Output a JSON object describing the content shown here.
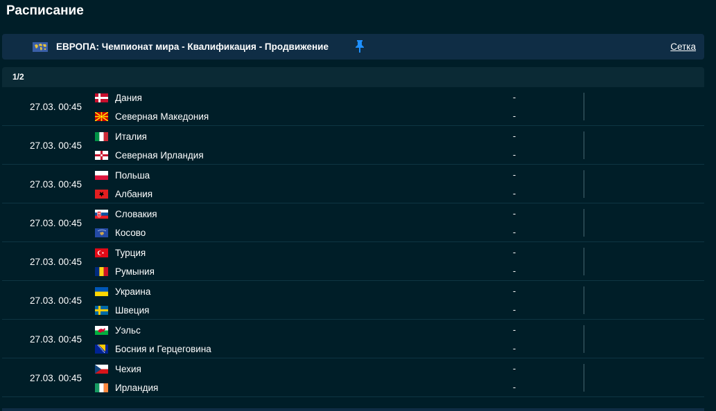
{
  "page": {
    "title": "Расписание"
  },
  "league": {
    "title": "ЕВРОПА: Чемпионат мира - Квалификация - Продвижение",
    "bracket_link": "Сетка",
    "flag_icon": "world-map-icon",
    "pin_icon": "pin-icon",
    "pin_color": "#1e90ff"
  },
  "round": {
    "label": "1/2"
  },
  "matches": [
    {
      "time": "27.03. 00:45",
      "home": {
        "name": "Дания",
        "flag": "denmark"
      },
      "away": {
        "name": "Северная Македония",
        "flag": "north-macedonia"
      },
      "home_score": "-",
      "away_score": "-"
    },
    {
      "time": "27.03. 00:45",
      "home": {
        "name": "Италия",
        "flag": "italy"
      },
      "away": {
        "name": "Северная Ирландия",
        "flag": "northern-ireland"
      },
      "home_score": "-",
      "away_score": "-"
    },
    {
      "time": "27.03. 00:45",
      "home": {
        "name": "Польша",
        "flag": "poland"
      },
      "away": {
        "name": "Албания",
        "flag": "albania"
      },
      "home_score": "-",
      "away_score": "-"
    },
    {
      "time": "27.03. 00:45",
      "home": {
        "name": "Словакия",
        "flag": "slovakia"
      },
      "away": {
        "name": "Косово",
        "flag": "kosovo"
      },
      "home_score": "-",
      "away_score": "-"
    },
    {
      "time": "27.03. 00:45",
      "home": {
        "name": "Турция",
        "flag": "turkey"
      },
      "away": {
        "name": "Румыния",
        "flag": "romania"
      },
      "home_score": "-",
      "away_score": "-"
    },
    {
      "time": "27.03. 00:45",
      "home": {
        "name": "Украина",
        "flag": "ukraine"
      },
      "away": {
        "name": "Швеция",
        "flag": "sweden"
      },
      "home_score": "-",
      "away_score": "-"
    },
    {
      "time": "27.03. 00:45",
      "home": {
        "name": "Уэльс",
        "flag": "wales"
      },
      "away": {
        "name": "Босния и Герцеговина",
        "flag": "bosnia-herzegovina"
      },
      "home_score": "-",
      "away_score": "-"
    },
    {
      "time": "27.03. 00:45",
      "home": {
        "name": "Чехия",
        "flag": "czechia"
      },
      "away": {
        "name": "Ирландия",
        "flag": "ireland"
      },
      "home_score": "-",
      "away_score": "-"
    }
  ],
  "colors": {
    "background": "#001e28",
    "header_bg": "#0f2d45",
    "round_bg": "#0b2a35",
    "row_border": "#0e3543",
    "text": "#ffffff"
  }
}
